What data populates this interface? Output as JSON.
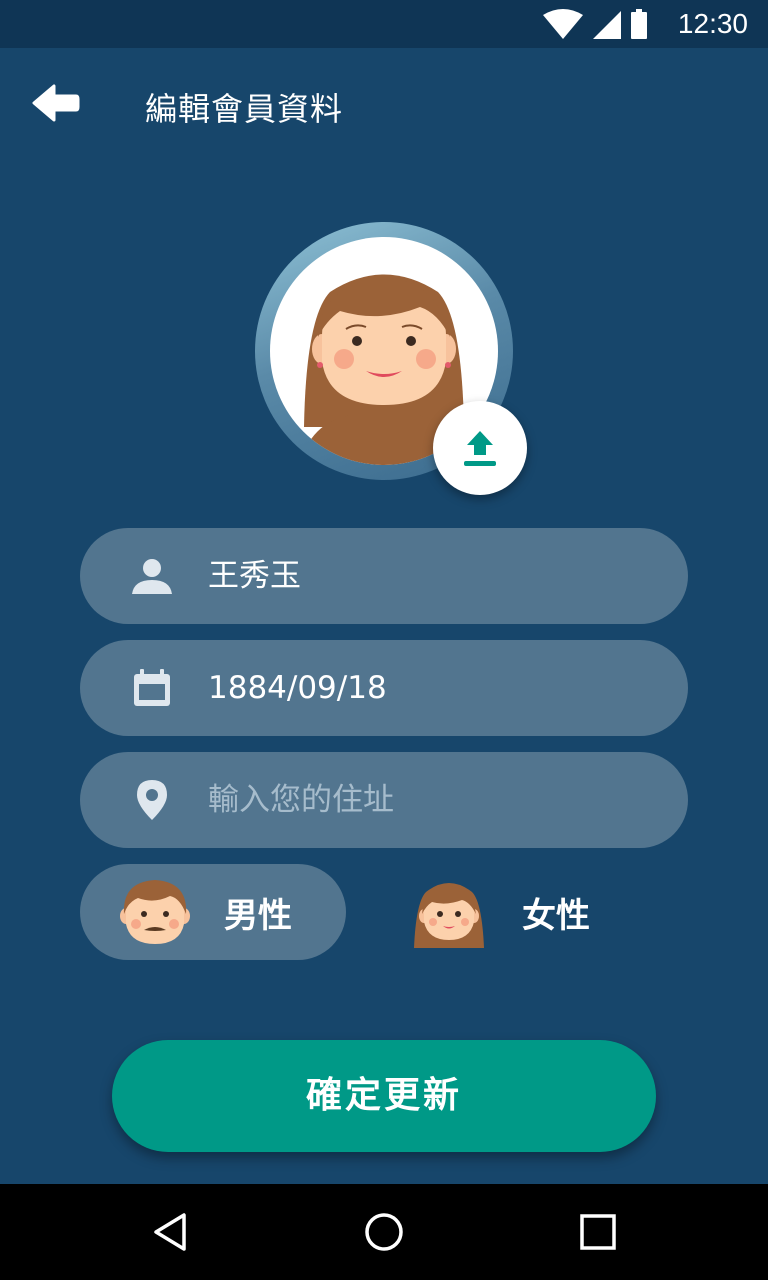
{
  "status_bar": {
    "time": "12:30",
    "icons": [
      "wifi-icon",
      "cellular-signal-icon",
      "battery-icon"
    ]
  },
  "header": {
    "title": "編輯會員資料",
    "back_icon": "arrow-left-icon"
  },
  "avatar": {
    "image": "female-avatar",
    "upload_icon": "upload-icon"
  },
  "form": {
    "name": {
      "icon": "person-icon",
      "value": "王秀玉"
    },
    "birthday": {
      "icon": "calendar-icon",
      "value": "1884/09/18"
    },
    "address": {
      "icon": "location-pin-icon",
      "value": "",
      "placeholder": "輸入您的住址"
    }
  },
  "gender": {
    "options": [
      {
        "label": "男性",
        "icon": "male-face-icon",
        "selected": true
      },
      {
        "label": "女性",
        "icon": "female-face-icon",
        "selected": false
      }
    ]
  },
  "confirm_button": {
    "label": "確定更新"
  },
  "nav_bar": {
    "icons": [
      "nav-back-icon",
      "nav-home-icon",
      "nav-recents-icon"
    ]
  },
  "colors": {
    "background": "#17466b",
    "status_bar": "#0f3555",
    "field_bg": "#52758f",
    "accent": "#009987",
    "icon_light": "#dfe7ee"
  }
}
